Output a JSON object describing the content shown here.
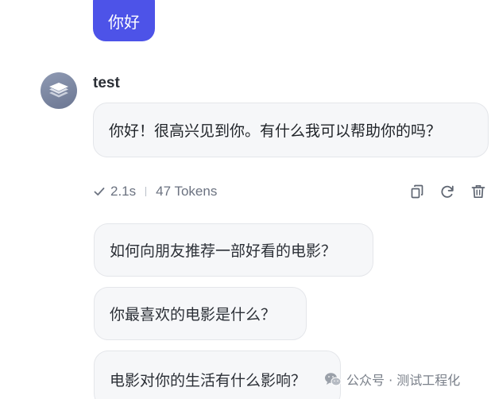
{
  "user_message": {
    "text": "你好"
  },
  "bot": {
    "name": "test",
    "reply": "你好！很高兴见到你。有什么我可以帮助你的吗？"
  },
  "meta": {
    "duration": "2.1s",
    "tokens": "47 Tokens"
  },
  "actions": {
    "copy_icon": "copy-icon",
    "regenerate_icon": "refresh-icon",
    "delete_icon": "trash-icon"
  },
  "suggestions": [
    "如何向朋友推荐一部好看的电影？",
    "你最喜欢的电影是什么？",
    "电影对你的生活有什么影响？"
  ],
  "watermark": {
    "text": "公众号 · 测试工程化"
  },
  "colors": {
    "user_bubble": "#4d53e8",
    "bubble_bg": "#f6f7f9",
    "muted_text": "#6b7280"
  }
}
